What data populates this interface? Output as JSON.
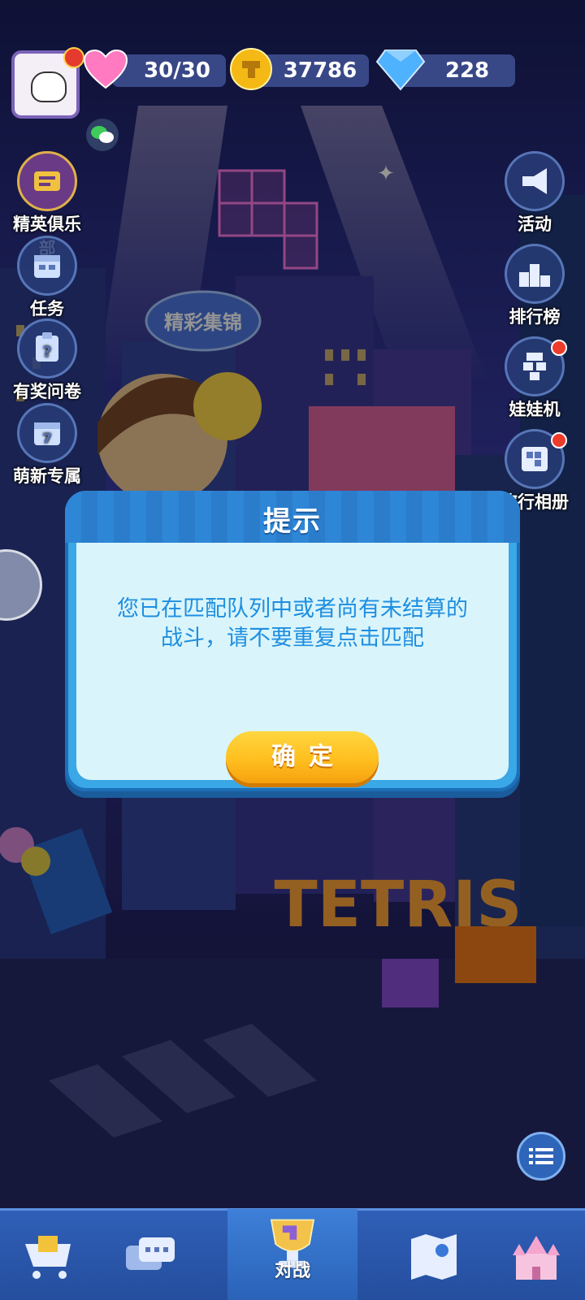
{
  "top_bar": {
    "hearts": "30/30",
    "coins": "37786",
    "diamonds": "228"
  },
  "left_menu": [
    {
      "label": "精英俱乐部",
      "icon": "club-badge-icon"
    },
    {
      "label": "任务",
      "icon": "calendar-task-icon"
    },
    {
      "label": "有奖问卷",
      "icon": "survey-clipboard-icon"
    },
    {
      "label": "萌新专属",
      "icon": "calendar-7-icon"
    }
  ],
  "right_menu": [
    {
      "label": "活动",
      "icon": "megaphone-icon",
      "dot": false
    },
    {
      "label": "排行榜",
      "icon": "podium-icon",
      "dot": false
    },
    {
      "label": "娃娃机",
      "icon": "claw-machine-icon",
      "dot": true
    },
    {
      "label": "旅行相册",
      "icon": "album-blocks-icon",
      "dot": true
    }
  ],
  "dialog": {
    "title": "提示",
    "message": "您已在匹配队列中或者尚有未结算的战斗，请不要重复点击匹配",
    "confirm_label": "确定"
  },
  "background": {
    "sign_text": "精彩集锦",
    "logo_text": "TETRIS"
  },
  "bottom_nav": {
    "active_label": "对战",
    "items": [
      "shop-cart-icon",
      "chat-bubbles-icon",
      "trophy-icon",
      "map-icon",
      "castle-icon"
    ]
  },
  "colors": {
    "dialog_blue": "#3aa7e6",
    "dialog_body": "#d9f5fb",
    "message_text": "#1f8ee0",
    "confirm_yellow": "#ffc42a"
  }
}
